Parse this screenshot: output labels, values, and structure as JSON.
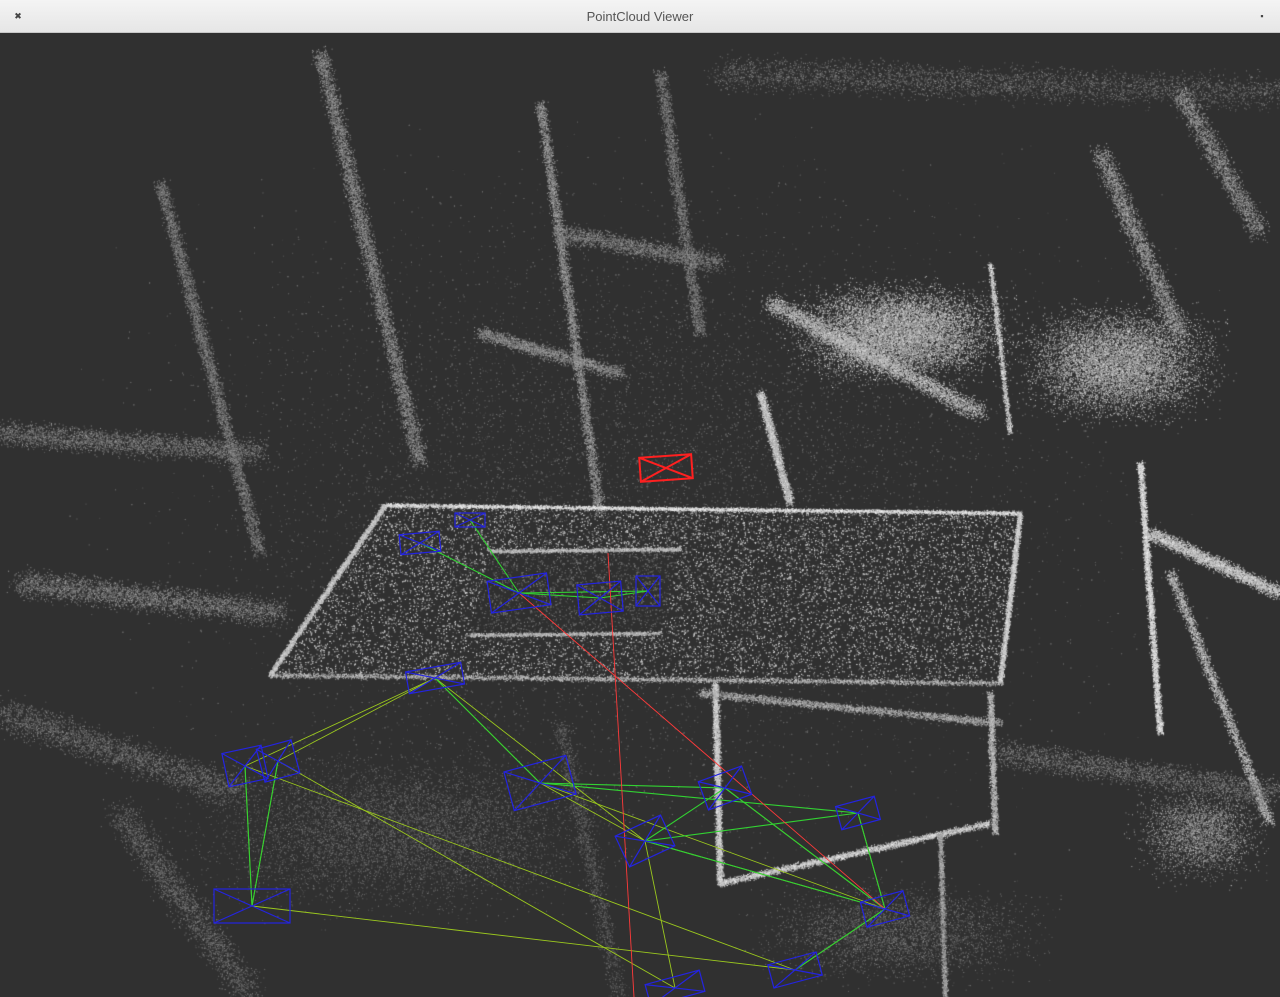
{
  "window": {
    "title": "PointCloud Viewer",
    "close_icon": "✖",
    "maximize_icon": "▪"
  },
  "viewport": {
    "background_color": "#303030",
    "point_color": "#d8d8d8",
    "current_frame_color": "#ff2020",
    "keyframe_color": "#2424e0",
    "covisibility_color": "#32d232",
    "graph_edge_color": "#9bc81e",
    "trajectory_color": "#ff3a3a"
  }
}
